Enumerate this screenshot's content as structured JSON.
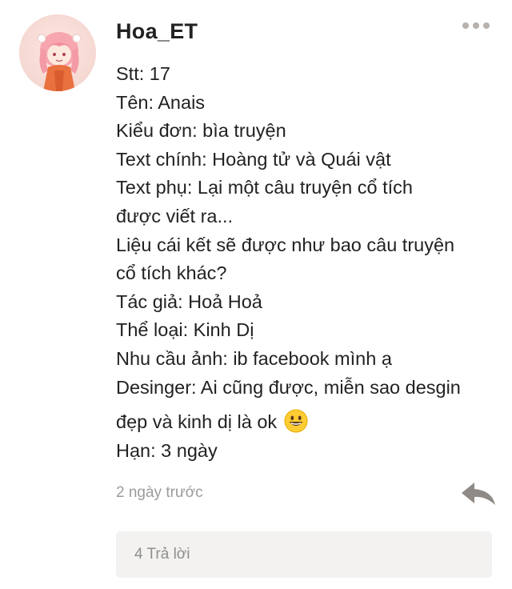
{
  "comment": {
    "username": "Hoa_ET",
    "body_lines": [
      "Stt: 17",
      "Tên: Anais",
      "Kiểu đơn: bìa truyện",
      "Text chính: Hoàng tử và Quái vật",
      "Text phụ: Lại một câu truyện cổ tích",
      "được viết ra...",
      "Liệu cái kết sẽ được như bao câu truyện",
      "cổ tích khác?",
      "Tác giả: Hoả Hoả",
      "Thể loại: Kinh Dị",
      "Nhu cầu ảnh: ib facebook mình ạ",
      "Desinger: Ai cũng được, miễn sao desgin",
      "đẹp và kinh dị là ok",
      "Hạn: 3 ngày"
    ],
    "timestamp": "2 ngày trước",
    "replies_label": "4 Trả lời"
  },
  "icons": {
    "more": "more-horizontal-icon",
    "reply": "reply-arrow-icon",
    "emoji": "grinning-face-emoji"
  },
  "colors": {
    "text": "#222222",
    "muted": "#9b9b9b",
    "icon_gray": "#b7b2ae",
    "reply_bar_bg": "#f3f2f1"
  }
}
